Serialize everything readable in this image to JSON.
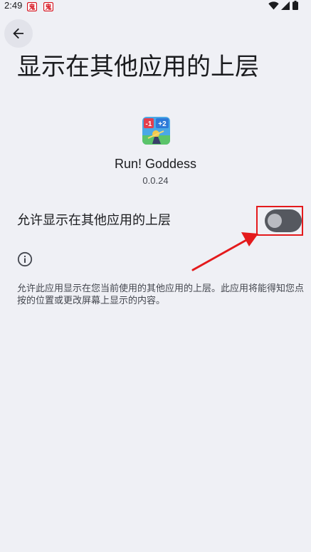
{
  "status_bar": {
    "time": "2:49",
    "notification_icons": [
      "app-notification-icon",
      "app-notification-icon"
    ],
    "system_icons": [
      "wifi-icon",
      "cellular-signal-icon",
      "battery-icon"
    ]
  },
  "header": {
    "back_icon": "arrow-back-icon",
    "title": "显示在其他应用的上层"
  },
  "app": {
    "icon": "run-goddess-app-icon",
    "name": "Run! Goddess",
    "version": "0.0.24",
    "icon_badges": [
      "-1",
      "+2"
    ]
  },
  "permission": {
    "label": "允许显示在其他应用的上层",
    "enabled": false
  },
  "info": {
    "icon": "info-icon",
    "text": "允许此应用显示在您当前使用的其他应用的上层。此应用将能得知您点按的位置或更改屏幕上显示的内容。"
  },
  "colors": {
    "background": "#eff0f5",
    "annotation_red": "#e41a1c",
    "toggle_track": "#55585f",
    "toggle_thumb": "#b9bbc1"
  }
}
